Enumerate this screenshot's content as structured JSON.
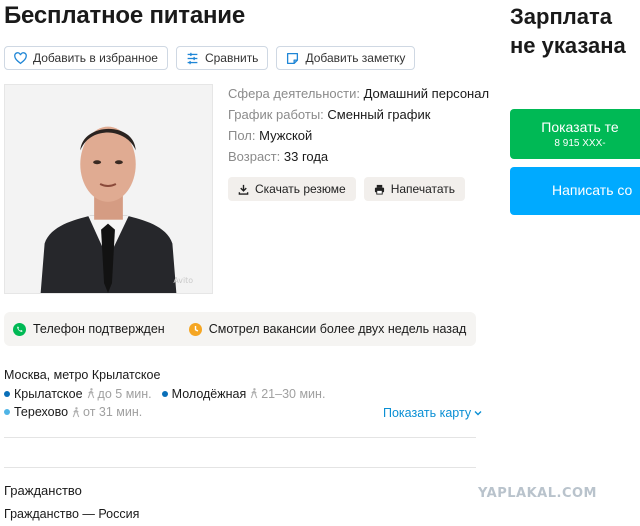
{
  "title": "Бесплатное питание",
  "salary": {
    "line1": "Зарплата",
    "line2": "не указана"
  },
  "actions": {
    "favorite": "Добавить в избранное",
    "compare": "Сравнить",
    "note": "Добавить заметку"
  },
  "info": {
    "sphere": {
      "label": "Сфера деятельности:",
      "value": "Домашний персонал"
    },
    "schedule": {
      "label": "График работы:",
      "value": "Сменный график"
    },
    "gender": {
      "label": "Пол:",
      "value": "Мужской"
    },
    "age": {
      "label": "Возраст:",
      "value": "33 года"
    }
  },
  "resume_actions": {
    "download": "Скачать резюме",
    "print": "Напечатать"
  },
  "contact": {
    "show_phone": "Показать те",
    "phone_masked": "8 915 XXX-",
    "write": "Написать со"
  },
  "status": {
    "phone_confirmed": "Телефон подтвержден",
    "last_seen": "Смотрел вакансии более двух недель назад"
  },
  "location": {
    "city": "Москва, метро Крылатское",
    "metros": [
      {
        "name": "Крылатское",
        "time": "до 5 мин.",
        "color": "#0a6fb8"
      },
      {
        "name": "Молодёжная",
        "time": "21–30 мин.",
        "color": "#0a6fb8"
      },
      {
        "name": "Терехово",
        "time": "от 31 мин.",
        "color": "#4fb4e6"
      }
    ],
    "show_map": "Показать карту"
  },
  "citizenship": {
    "title": "Гражданство",
    "text": "Гражданство — Россия"
  },
  "watermark": "YAPLAKAL.COM",
  "colors": {
    "green": "#00b955",
    "blue": "#00aaff",
    "link": "#0a8fd4",
    "status_bg": "#f5f4f2"
  }
}
